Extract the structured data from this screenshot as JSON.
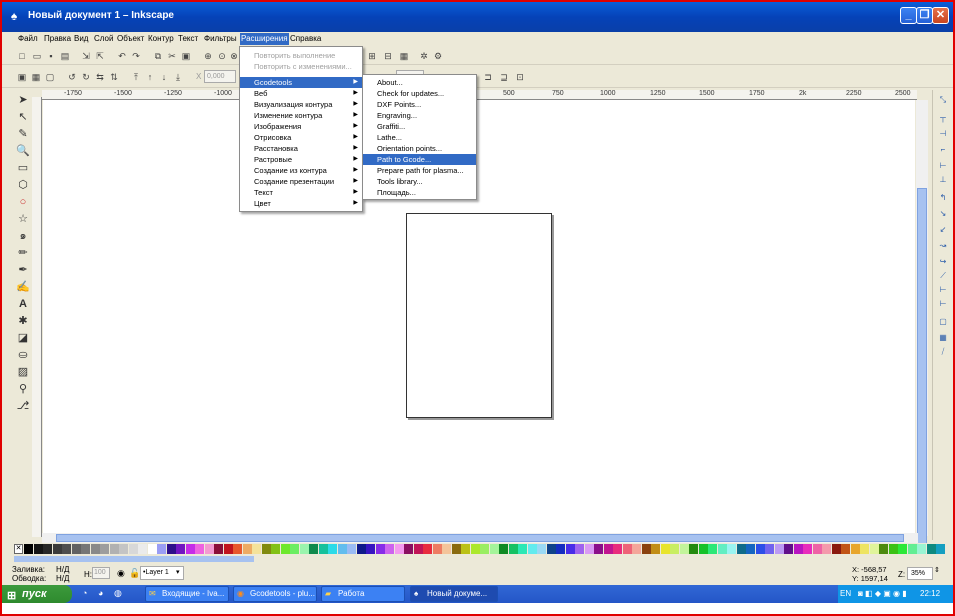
{
  "window": {
    "title": "Новый документ 1 – Inkscape"
  },
  "menubar": {
    "items": [
      "Файл",
      "Правка",
      "Вид",
      "Слой",
      "Объект",
      "Контур",
      "Текст",
      "Фильтры",
      "Расширения",
      "Справка"
    ]
  },
  "toolbar2": {
    "x_label": "X",
    "x_value": "0,000"
  },
  "ruler": {
    "labels": [
      "-1750",
      "-1500",
      "-1250",
      "-1000",
      "500",
      "750",
      "1000",
      "1250",
      "1500",
      "1750",
      "2k",
      "2250",
      "2500"
    ]
  },
  "extensions_menu": {
    "items": [
      {
        "label": "Повторить выполнение",
        "disabled": true
      },
      {
        "label": "Повторить с изменениями...",
        "disabled": true
      },
      {
        "label": "Gcodetools",
        "submenu": true,
        "highlighted": true
      },
      {
        "label": "Веб",
        "submenu": true
      },
      {
        "label": "Визуализация контура",
        "submenu": true
      },
      {
        "label": "Изменение контура",
        "submenu": true
      },
      {
        "label": "Изображения",
        "submenu": true
      },
      {
        "label": "Отрисовка",
        "submenu": true
      },
      {
        "label": "Расстановка",
        "submenu": true
      },
      {
        "label": "Растровые",
        "submenu": true
      },
      {
        "label": "Создание из контура",
        "submenu": true
      },
      {
        "label": "Создание презентации",
        "submenu": true
      },
      {
        "label": "Текст",
        "submenu": true
      },
      {
        "label": "Цвет",
        "submenu": true
      }
    ]
  },
  "gcodetools_menu": {
    "items": [
      {
        "label": "About..."
      },
      {
        "label": "Check for updates..."
      },
      {
        "label": "DXF Points..."
      },
      {
        "label": "Engraving..."
      },
      {
        "label": "Graffiti..."
      },
      {
        "label": "Lathe..."
      },
      {
        "label": "Orientation points..."
      },
      {
        "label": "Path to Gcode...",
        "highlighted": true
      },
      {
        "label": "Prepare path for plasma..."
      },
      {
        "label": "Tools library..."
      },
      {
        "label": "Площадь..."
      }
    ]
  },
  "status": {
    "fill_label": "Заливка:",
    "fill_value": "Н/Д",
    "stroke_label": "Обводка:",
    "stroke_value": "Н/Д",
    "h_label": "H:",
    "h_value": "100",
    "layer": "•Layer 1",
    "coords_x": "X: -568,57",
    "coords_y": "Y: 1597,14",
    "zoom_label": "Z:",
    "zoom_value": "35%"
  },
  "taskbar": {
    "start_label": "пуск",
    "tasks": [
      "Входящие - Iva...",
      "Gcodetools - plu...",
      "Работа",
      "Новый докуме..."
    ],
    "lang": "EN",
    "clock": "22:12"
  },
  "colors": {
    "accent": "#316ac5",
    "titlebar": "#0542b8",
    "frame": "#e00000"
  }
}
